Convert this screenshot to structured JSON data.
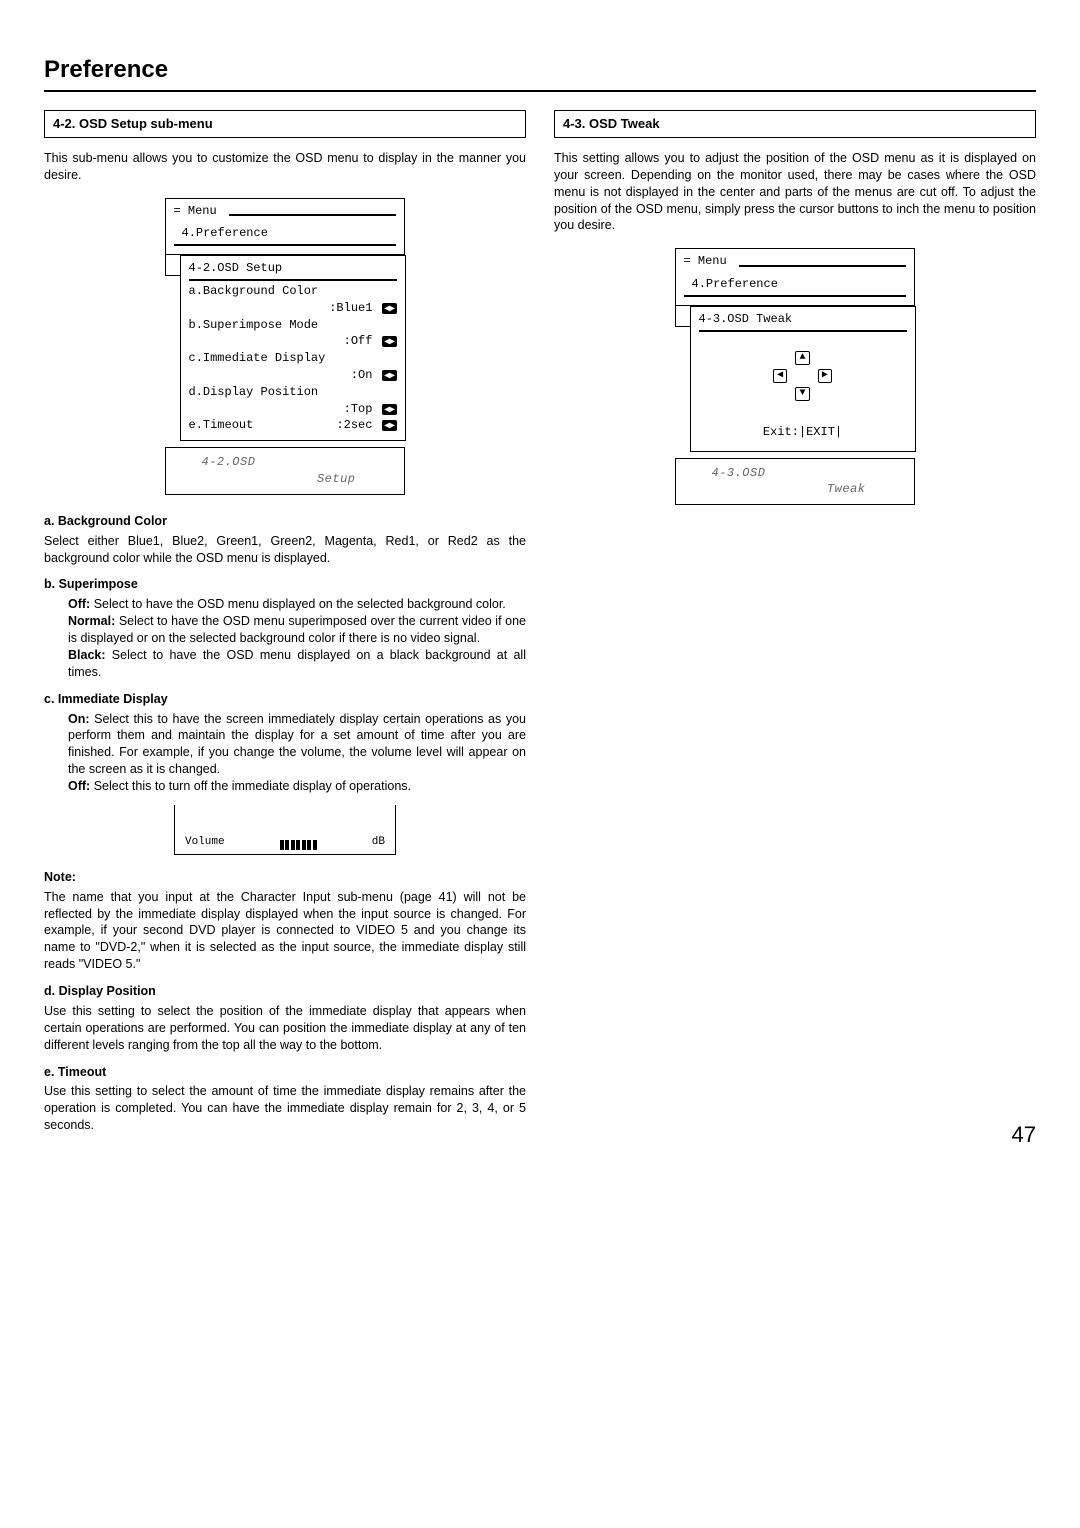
{
  "page_title": "Preference",
  "page_number": "47",
  "left": {
    "heading": "4-2. OSD Setup sub-menu",
    "intro": "This sub-menu allows you to customize the OSD menu to display in the manner you desire.",
    "menu": {
      "top": "= Menu",
      "level1": "4.Preference",
      "level2": "4-2.OSD Setup",
      "items": {
        "a_label": "a.Background Color",
        "a_value": ":Blue1",
        "b_label": "b.Superimpose Mode",
        "b_value": ":Off",
        "c_label": "c.Immediate Display",
        "c_value": ":On",
        "d_label": "d.Display Position",
        "d_value": ":Top",
        "e_label": "e.Timeout",
        "e_value": ":2sec"
      },
      "footer_line1": "4-2.OSD",
      "footer_line2": "Setup"
    },
    "a_head": "a. Background Color",
    "a_body": "Select either Blue1, Blue2, Green1, Green2, Magenta, Red1, or Red2 as the background color while the OSD menu is displayed.",
    "b_head": "b. Superimpose",
    "b_off_lbl": "Off:",
    "b_off": "Select to have the OSD menu displayed on the selected background color.",
    "b_norm_lbl": "Normal:",
    "b_norm": "Select to have the OSD menu superimposed over the current video if one is displayed or on the selected background color if there is no video signal.",
    "b_black_lbl": "Black:",
    "b_black": "Select to have the OSD menu displayed on a black background at all times.",
    "c_head": "c. Immediate Display",
    "c_on_lbl": "On:",
    "c_on": "Select this to have the screen immediately display certain operations as you perform them and maintain the display for a set amount of time after you are finished. For example, if you change the volume, the volume level will appear on the screen as it is changed.",
    "c_off_lbl": "Off:",
    "c_off": "Select this to turn off the immediate display of operations.",
    "vol_label": "Volume",
    "vol_unit": "dB",
    "note_head": "Note:",
    "note_body": "The name that you input at the Character Input sub-menu (page 41) will not be reflected by the immediate display displayed when the input source is changed. For example, if your second DVD player is connected to VIDEO 5 and you change its name to \"DVD-2,\" when it is selected as the input source, the immediate display still reads \"VIDEO 5.\"",
    "d_head": "d. Display Position",
    "d_body": "Use this setting to select the position of the immediate display that appears when certain operations are performed. You can position the immediate display at any of ten different levels ranging from the top all the way to the bottom.",
    "e_head": "e. Timeout",
    "e_body": "Use this setting to select the amount of time the immediate display remains after the operation is completed. You can have the immediate display remain for 2, 3, 4, or 5 seconds."
  },
  "right": {
    "heading": "4-3. OSD Tweak",
    "intro": "This setting allows you to adjust the position of the OSD menu as it is displayed on your screen. Depending on the monitor used, there may be cases where the OSD menu is not displayed in the center and parts of the menus are cut off. To adjust the position of the OSD menu, simply press the cursor buttons to inch the menu to position you desire.",
    "menu": {
      "top": "= Menu",
      "level1": "4.Preference",
      "level2": "4-3.OSD Tweak",
      "exit": "Exit:|EXIT|",
      "footer_line1": "4-3.OSD",
      "footer_line2": "Tweak"
    }
  }
}
